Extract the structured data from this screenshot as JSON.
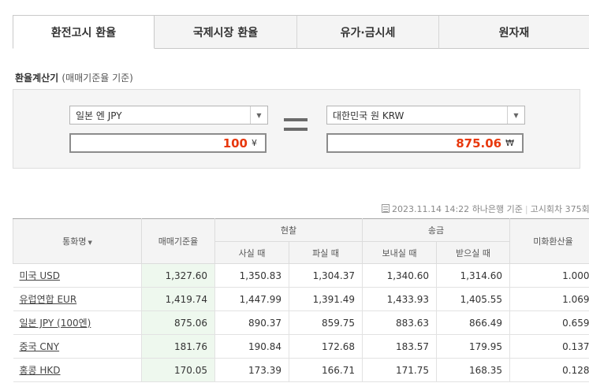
{
  "tabs": [
    {
      "label": "환전고시 환율",
      "active": true
    },
    {
      "label": "국제시장 환율",
      "active": false
    },
    {
      "label": "유가·금시세",
      "active": false
    },
    {
      "label": "원자재",
      "active": false
    }
  ],
  "calculator": {
    "title": "환율계산기",
    "subtitle": "(매매기준율 기준)",
    "from_currency": "일본 엔 JPY",
    "from_amount": "100",
    "from_unit": "¥",
    "to_currency": "대한민국 원 KRW",
    "to_amount": "875.06",
    "to_unit": "₩"
  },
  "info": {
    "timestamp": "2023.11.14 14:22",
    "bank": "하나은행 기준",
    "round": "고시회차 375회"
  },
  "table": {
    "headers": {
      "currency": "통화명",
      "base_rate": "매매기준율",
      "cash": "현찰",
      "cash_buy": "사실 때",
      "cash_sell": "파실 때",
      "wire": "송금",
      "wire_send": "보내실 때",
      "wire_receive": "받으실 때",
      "usd_rate": "미화환산율"
    },
    "rows": [
      {
        "name": "미국 USD",
        "base": "1,327.60",
        "cash_buy": "1,350.83",
        "cash_sell": "1,304.37",
        "send": "1,340.60",
        "receive": "1,314.60",
        "usd": "1.000"
      },
      {
        "name": "유럽연합 EUR",
        "base": "1,419.74",
        "cash_buy": "1,447.99",
        "cash_sell": "1,391.49",
        "send": "1,433.93",
        "receive": "1,405.55",
        "usd": "1.069"
      },
      {
        "name": "일본 JPY (100엔)",
        "base": "875.06",
        "cash_buy": "890.37",
        "cash_sell": "859.75",
        "send": "883.63",
        "receive": "866.49",
        "usd": "0.659"
      },
      {
        "name": "중국 CNY",
        "base": "181.76",
        "cash_buy": "190.84",
        "cash_sell": "172.68",
        "send": "183.57",
        "receive": "179.95",
        "usd": "0.137"
      },
      {
        "name": "홍콩 HKD",
        "base": "170.05",
        "cash_buy": "173.39",
        "cash_sell": "166.71",
        "send": "171.75",
        "receive": "168.35",
        "usd": "0.128"
      }
    ]
  }
}
